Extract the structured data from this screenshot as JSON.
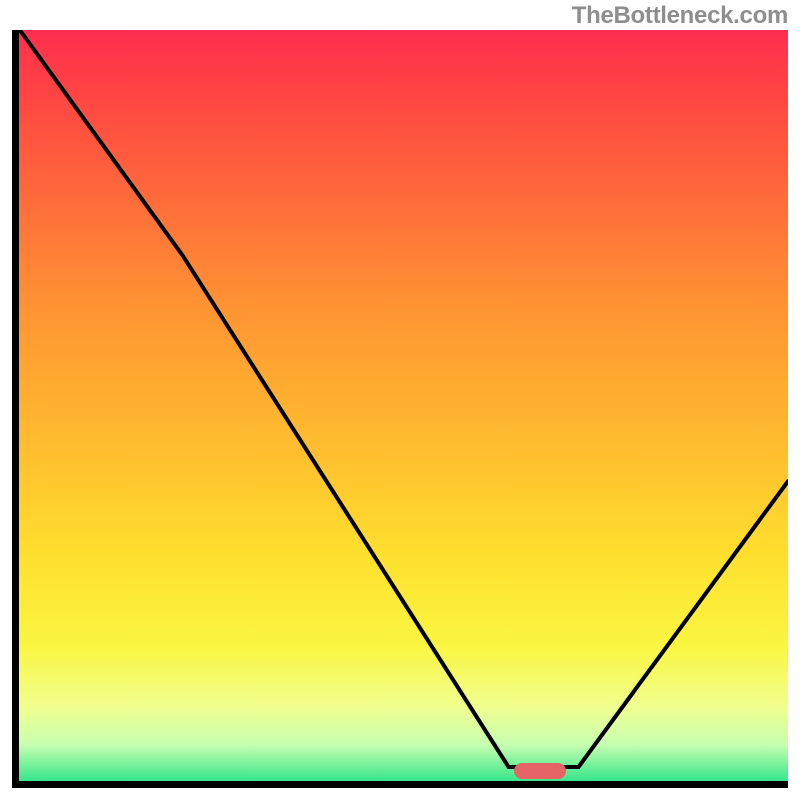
{
  "watermark": "TheBottleneck.com",
  "chart_data": {
    "type": "line",
    "title": "",
    "xlabel": "",
    "ylabel": "",
    "xlim": [
      0,
      100
    ],
    "ylim": [
      0,
      100
    ],
    "grid": false,
    "legend": null,
    "series": [
      {
        "name": "bottleneck-curve",
        "x": [
          1,
          22,
          64,
          73,
          100
        ],
        "y": [
          100,
          70,
          2,
          2,
          40
        ],
        "color": "#000000"
      }
    ],
    "marker": {
      "x": 68,
      "y": 1.5,
      "color": "#e56468"
    },
    "background_gradient": {
      "stops": [
        {
          "pct": 0,
          "color": "#ff2e50"
        },
        {
          "pct": 7,
          "color": "#ff4044"
        },
        {
          "pct": 22,
          "color": "#ff6a3b"
        },
        {
          "pct": 38,
          "color": "#ff9632"
        },
        {
          "pct": 55,
          "color": "#ffbc2f"
        },
        {
          "pct": 70,
          "color": "#ffe02e"
        },
        {
          "pct": 82,
          "color": "#faf642"
        },
        {
          "pct": 90,
          "color": "#f0ff8f"
        },
        {
          "pct": 95,
          "color": "#c7ffb0"
        },
        {
          "pct": 100,
          "color": "#33e58a"
        }
      ]
    },
    "axes": {
      "color": "#000000",
      "thickness_px": 7
    }
  }
}
